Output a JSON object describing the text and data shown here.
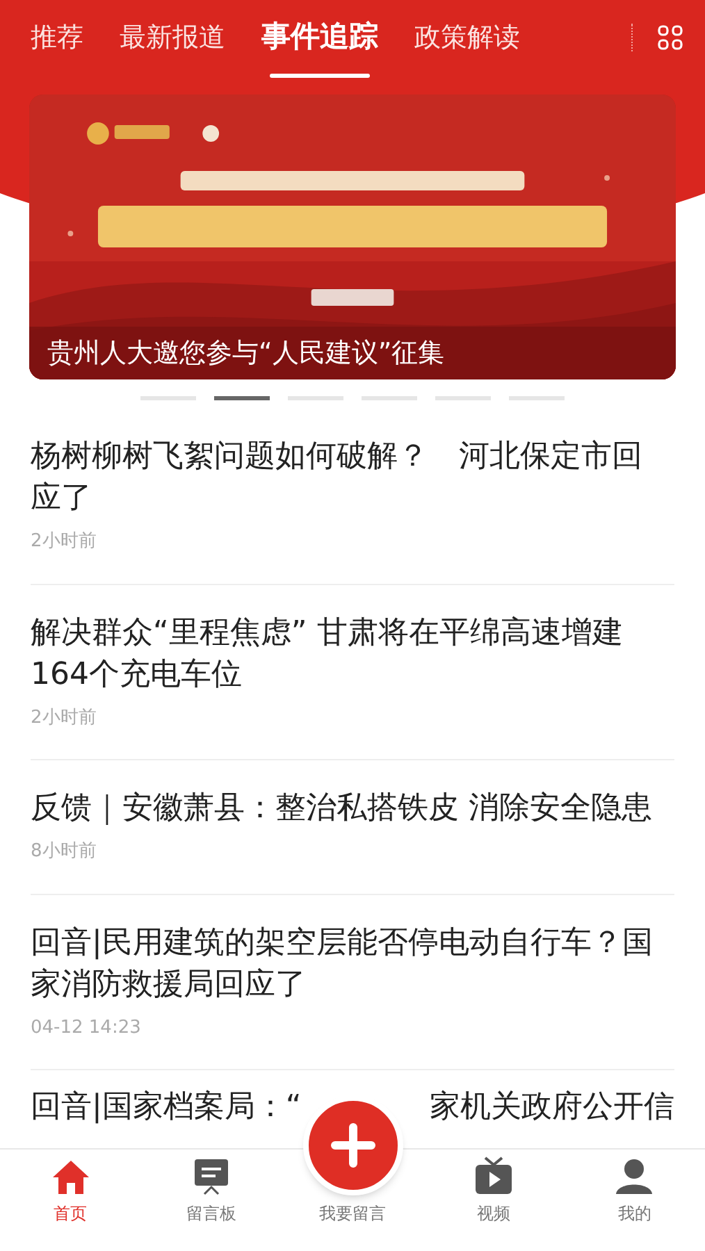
{
  "tabs": [
    {
      "label": "推荐",
      "selected": false
    },
    {
      "label": "最新报道",
      "selected": false
    },
    {
      "label": "事件追踪",
      "selected": true
    },
    {
      "label": "政策解读",
      "selected": false
    }
  ],
  "banner": {
    "caption": "贵州人大邀您参与“人民建议”征集",
    "slides": [
      {
        "selected": false
      },
      {
        "selected": true
      },
      {
        "selected": false
      },
      {
        "selected": false
      },
      {
        "selected": false
      },
      {
        "selected": false
      }
    ]
  },
  "articles": [
    {
      "title": "杨树柳树飞絮问题如何破解？　河北保定市回应了",
      "time": "2小时前"
    },
    {
      "title": "解决群众“里程焦虑” 甘肃将在平绵高速增建164个充电车位",
      "time": "2小时前"
    },
    {
      "title": "反馈｜安徽萧县：整治私搭铁皮 消除安全隐患",
      "time": "8小时前"
    },
    {
      "title": "回音|民用建筑的架空层能否停电动自行车？国家消防救援局回应了",
      "time": "04-12 14:23"
    }
  ],
  "partial_article": {
    "title_left": "回音|国家档案局：“",
    "title_right": "家机关政府公开信"
  },
  "bottom_nav": [
    {
      "label": "首页",
      "kind": "home",
      "selected": true
    },
    {
      "label": "留言板",
      "kind": "board",
      "selected": false
    },
    {
      "label": "我要留言",
      "kind": "plus",
      "selected": false
    },
    {
      "label": "视频",
      "kind": "tv",
      "selected": false
    },
    {
      "label": "我的",
      "kind": "user",
      "selected": false
    }
  ]
}
